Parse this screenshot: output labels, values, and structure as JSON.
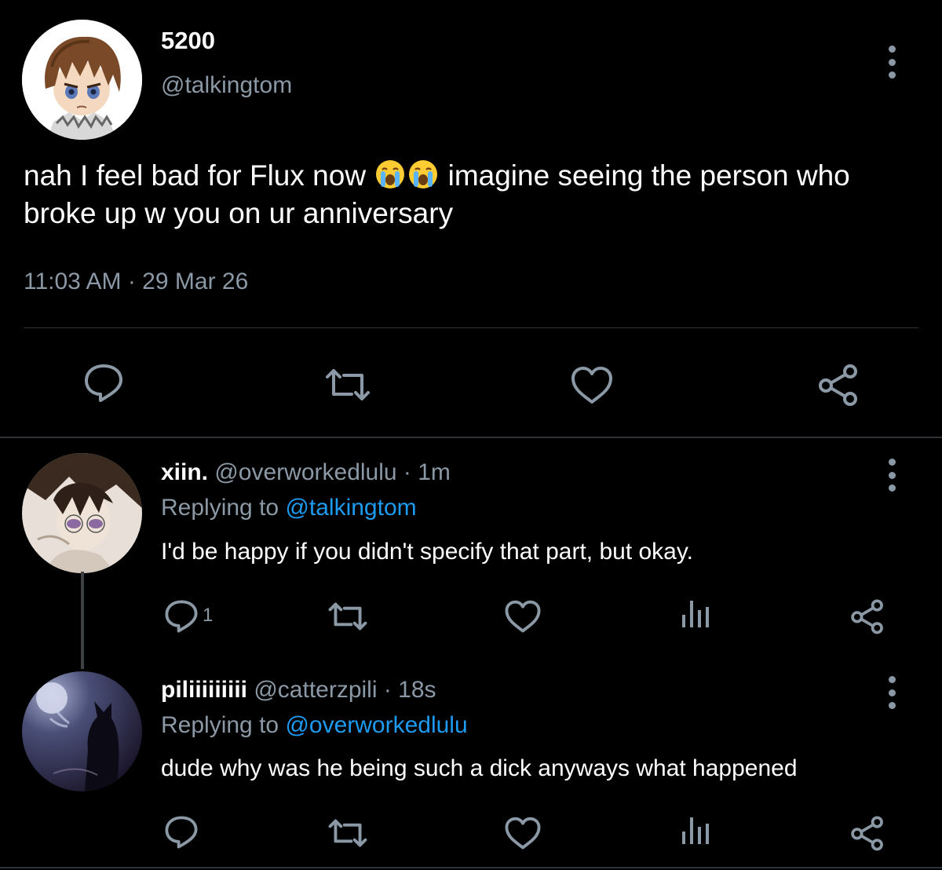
{
  "main_tweet": {
    "display_name": "5200",
    "handle": "@talkingtom",
    "text_before_emoji": "nah I feel bad for Flux now ",
    "emoji": [
      "loudly-crying-face",
      "loudly-crying-face"
    ],
    "text_after_emoji": " imagine seeing the person who broke up w you on ur anniversary",
    "timestamp": "11:03 AM · 29 Mar 26",
    "actions": [
      "reply-icon",
      "retweet-icon",
      "like-icon",
      "share-icon"
    ]
  },
  "replies": [
    {
      "display_name": "xiin.",
      "meta": " @overworkedlulu · 1m",
      "replying_prefix": "Replying to ",
      "replying_to": "@talkingtom",
      "text": "I'd be happy if you didn't specify that part, but okay.",
      "reply_count": "1",
      "actions": [
        "reply-icon",
        "retweet-icon",
        "like-icon",
        "analytics-icon",
        "share-icon"
      ]
    },
    {
      "display_name": "piliiiiiiiii",
      "meta": " @catterzpili · 18s",
      "replying_prefix": "Replying to ",
      "replying_to": "@overworkedlulu",
      "text": "dude why was he being such a dick anyways what happened",
      "actions": [
        "reply-icon",
        "retweet-icon",
        "like-icon",
        "analytics-icon",
        "share-icon"
      ]
    }
  ],
  "colors": {
    "background": "#000000",
    "text_primary": "#ffffff",
    "text_secondary": "#8b98a5",
    "link": "#1d9bf0",
    "divider": "#2f3336"
  }
}
